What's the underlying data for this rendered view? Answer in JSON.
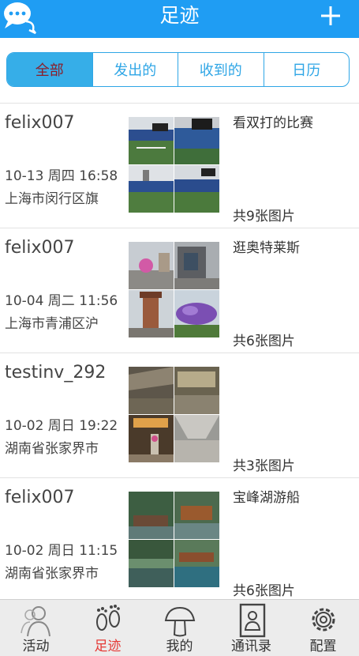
{
  "header": {
    "title": "足迹",
    "chat_icon": "chat-bubbles-icon",
    "add_icon": "plus-icon",
    "color": "#1f9df3"
  },
  "tabs": [
    {
      "label": "全部",
      "active": true
    },
    {
      "label": "发出的",
      "active": false
    },
    {
      "label": "收到的",
      "active": false
    },
    {
      "label": "日历",
      "active": false
    }
  ],
  "posts": [
    {
      "user": "felix007",
      "time": "10-13 周四 16:58",
      "place": "上海市闵行区旗",
      "caption": "看双打的比赛",
      "count": "共9张图片",
      "photos": [
        "tennis-stadium-photo",
        "tennis-stadium-photo",
        "tennis-stadium-photo",
        "tennis-stadium-photo"
      ]
    },
    {
      "user": "felix007",
      "time": "10-04 周二 11:56",
      "place": "上海市青浦区沪",
      "caption": "逛奥特莱斯",
      "count": "共6张图片",
      "photos": [
        "outlet-street-photo",
        "outlet-building-photo",
        "clock-tower-photo",
        "purple-flowers-photo"
      ]
    },
    {
      "user": "testinv_292",
      "time": "10-02 周日 19:22",
      "place": "湖南省张家界市",
      "caption": "",
      "count": "共3张图片",
      "photos": [
        "station-hall-photo",
        "station-hall-photo",
        "station-corridor-photo",
        "station-corridor-photo"
      ]
    },
    {
      "user": "felix007",
      "time": "10-02 周日 11:15",
      "place": "湖南省张家界市",
      "caption": "宝峰湖游船",
      "count": "共6张图片",
      "photos": [
        "lake-boat-photo",
        "lake-boat-photo",
        "lake-boat-photo",
        "lake-boat-photo"
      ]
    }
  ],
  "bottom_nav": [
    {
      "label": "活动",
      "icon": "people-icon",
      "active": false
    },
    {
      "label": "足迹",
      "icon": "footprints-icon",
      "active": true
    },
    {
      "label": "我的",
      "icon": "mushroom-icon",
      "active": false
    },
    {
      "label": "通讯录",
      "icon": "contacts-book-icon",
      "active": false
    },
    {
      "label": "配置",
      "icon": "gear-icon",
      "active": false
    }
  ],
  "colors": {
    "accent": "#1f9df3",
    "tab_active_text": "#8a1f2a",
    "nav_active": "#e53a36"
  }
}
